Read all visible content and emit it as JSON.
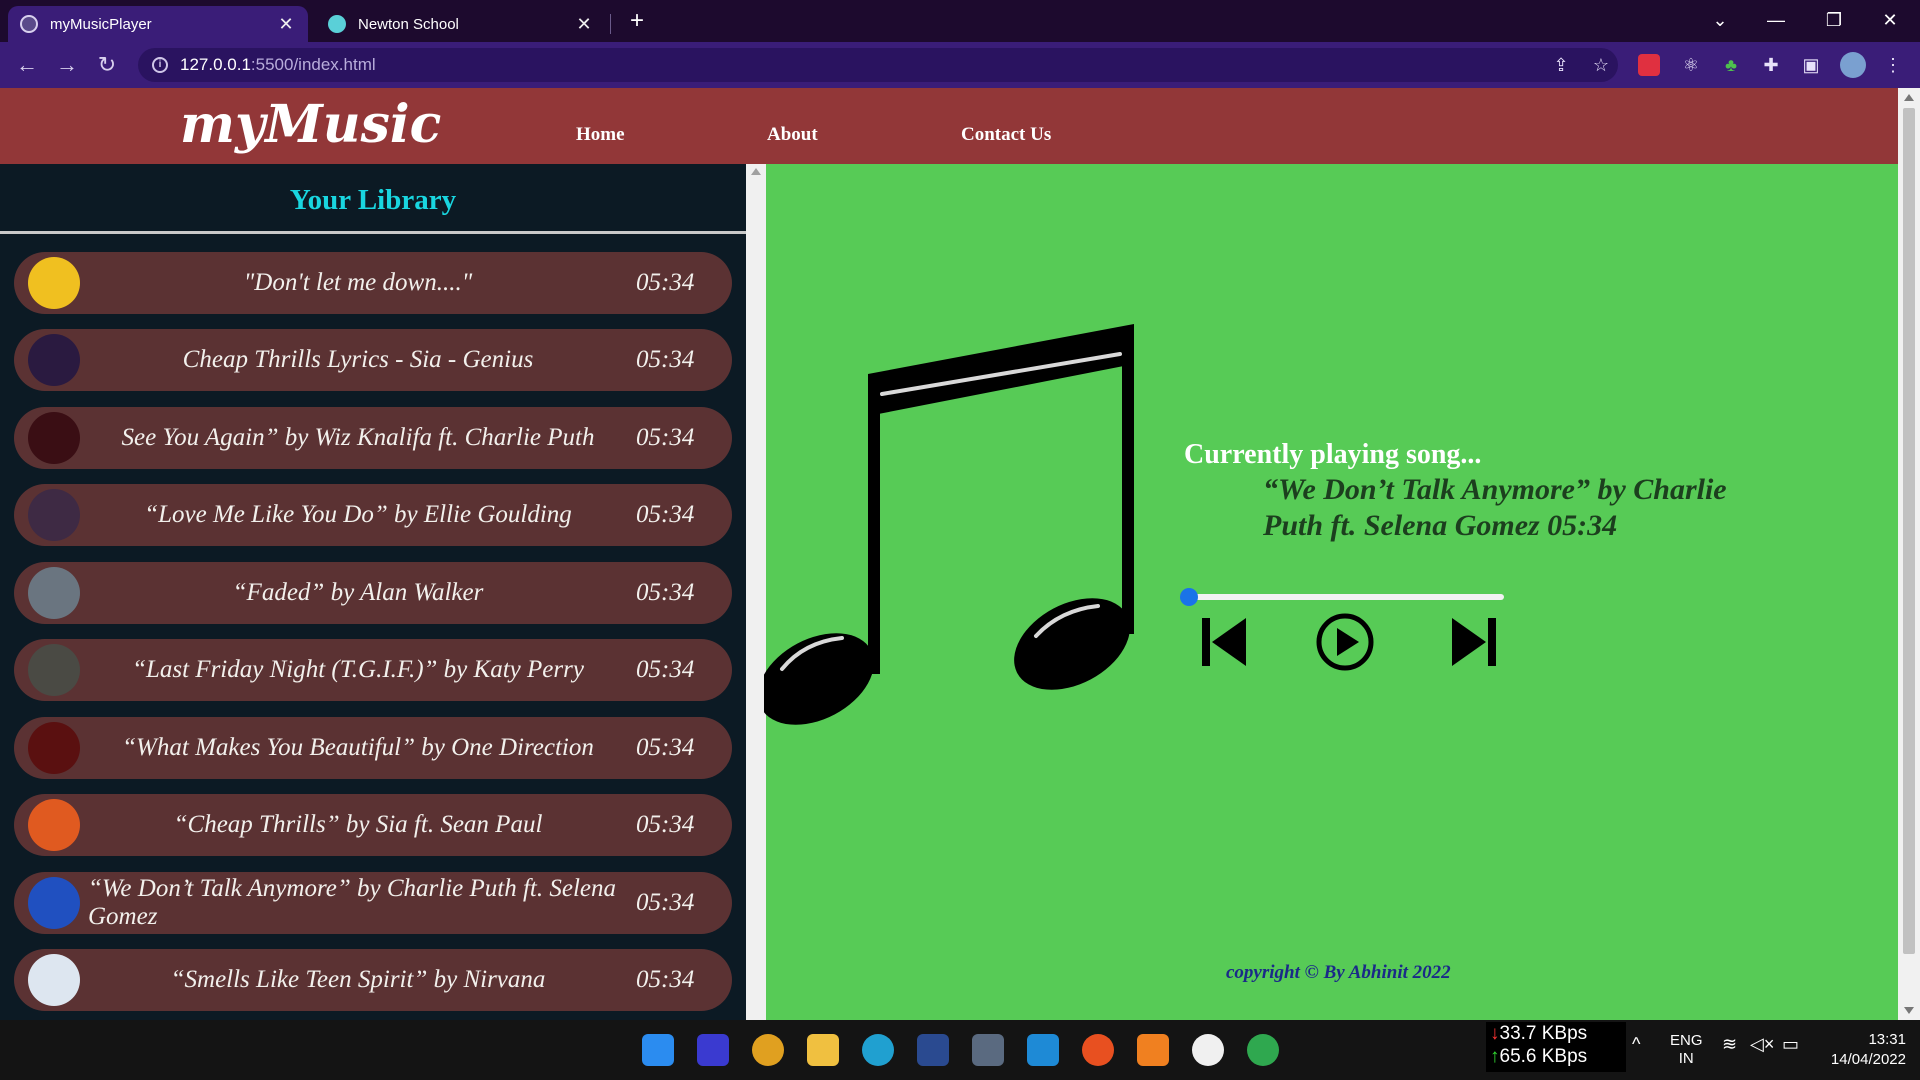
{
  "browser": {
    "tabs": [
      {
        "label": "myMusicPlayer",
        "active": true
      },
      {
        "label": "Newton School",
        "active": false
      }
    ],
    "url_host": "127.0.0.1",
    "url_rest": ":5500/index.html"
  },
  "site": {
    "brand": "myMusic",
    "nav": [
      "Home",
      "About",
      "Contact Us"
    ]
  },
  "library": {
    "title": "Your Library",
    "songs": [
      {
        "name": "\"Don't let me down....\"",
        "duration": "05:34"
      },
      {
        "name": "Cheap Thrills Lyrics - Sia - Genius",
        "duration": "05:34"
      },
      {
        "name": "See You Again” by Wiz Knalifa ft. Charlie Puth",
        "duration": "05:34"
      },
      {
        "name": "“Love Me Like You Do” by Ellie Goulding",
        "duration": "05:34"
      },
      {
        "name": "“Faded” by Alan Walker",
        "duration": "05:34"
      },
      {
        "name": "“Last Friday Night (T.G.I.F.)” by Katy Perry",
        "duration": "05:34"
      },
      {
        "name": "“What Makes You Beautiful” by One Direction",
        "duration": "05:34"
      },
      {
        "name": "“Cheap Thrills” by Sia ft. Sean Paul",
        "duration": "05:34"
      },
      {
        "name": "“We Don’t Talk Anymore” by Charlie Puth ft. Selena Gomez",
        "duration": "05:34"
      },
      {
        "name": "“Smells Like Teen Spirit” by Nirvana",
        "duration": "05:34"
      }
    ]
  },
  "player": {
    "label": "Currently playing song...",
    "song": "“We Don’t Talk Anymore” by Charlie Puth ft. Selena Gomez 05:34",
    "progress": 0,
    "copyright": "copyright © By Abhinit 2022"
  },
  "taskbar": {
    "download_speed": "33.7 KBps",
    "upload_speed": "65.6 KBps",
    "lang_top": "ENG",
    "lang_bottom": "IN",
    "time": "13:31",
    "date": "14/04/2022"
  },
  "colors": {
    "navbar": "#923738",
    "player_bg": "#57cb56",
    "library_bg": "#0c1a24",
    "song_item": "#5b3233",
    "library_title": "#19d6e0"
  }
}
